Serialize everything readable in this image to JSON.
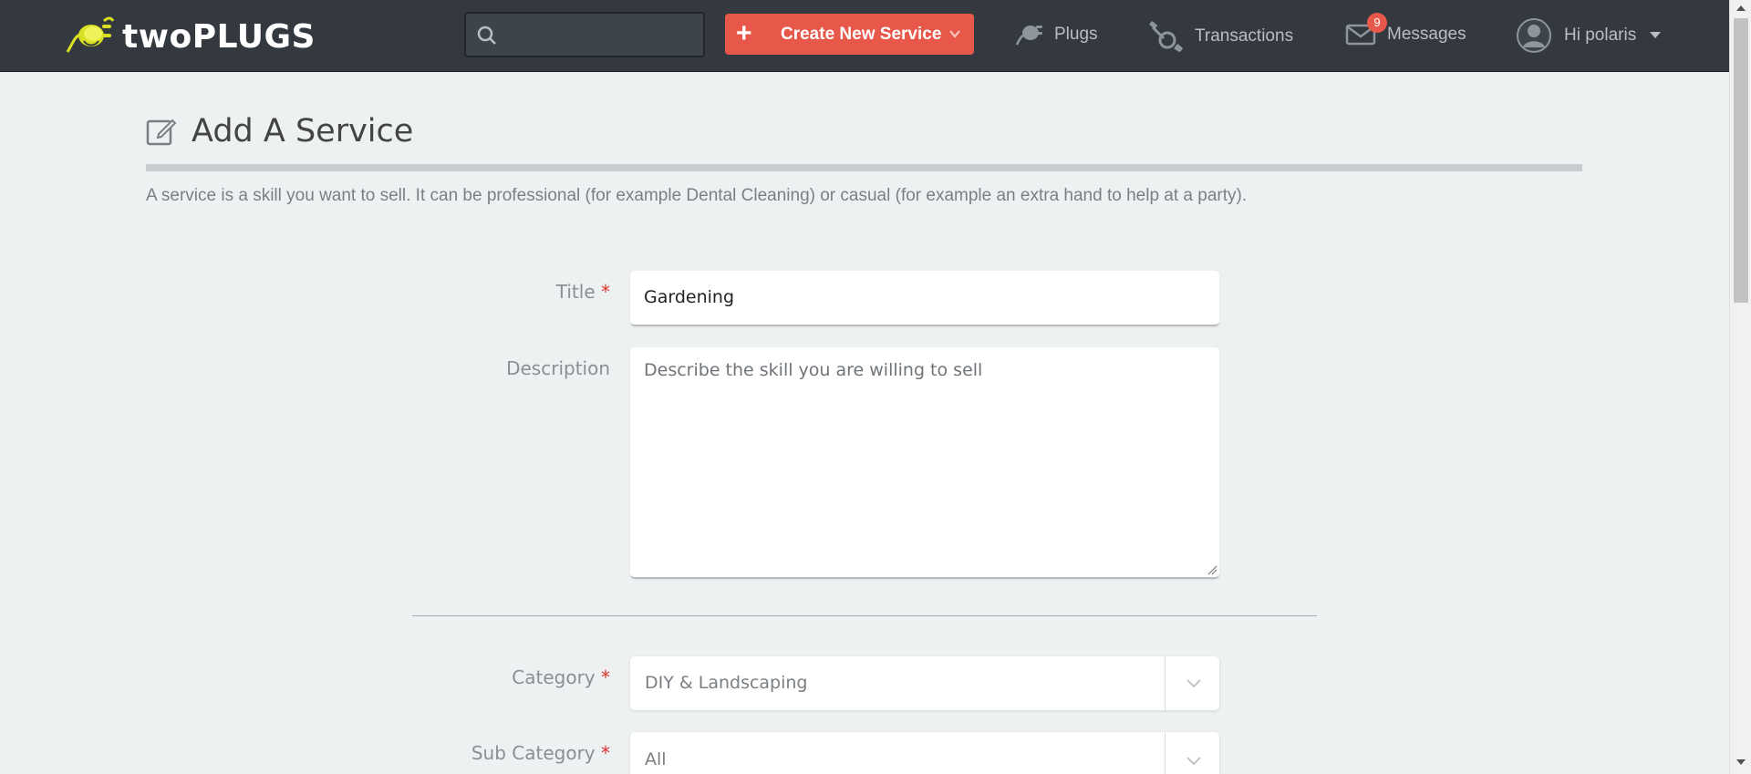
{
  "header": {
    "brand": "twoPLUGS",
    "search_placeholder": "",
    "create_label": "Create New Service",
    "nav": {
      "plugs": "Plugs",
      "transactions": "Transactions",
      "messages": "Messages",
      "messages_count": "9"
    },
    "user_greeting": "Hi polaris"
  },
  "page": {
    "title": "Add A Service",
    "intro": "A service is a skill you want to sell. It can be professional (for example Dental Cleaning) or casual (for example an extra hand to help at a party)."
  },
  "form": {
    "title_label": "Title",
    "title_value": "Gardening",
    "description_label": "Description",
    "description_placeholder": "Describe the skill you are willing to sell",
    "category_label": "Category",
    "category_value": "DIY & Landscaping",
    "subcategory_label": "Sub Category",
    "subcategory_value": "All",
    "required_mark": "*"
  },
  "colors": {
    "header_bg": "#33393f",
    "accent": "#e8584a",
    "page_bg": "#eef1f2",
    "logo_yellow": "#d8e021"
  },
  "icons": {
    "search": "search-icon",
    "plus": "plus-icon",
    "caret": "chevron-down-icon",
    "plugs": "plug-icon",
    "transactions": "transactions-icon",
    "messages": "envelope-icon",
    "user": "avatar-icon",
    "edit": "edit-icon"
  }
}
